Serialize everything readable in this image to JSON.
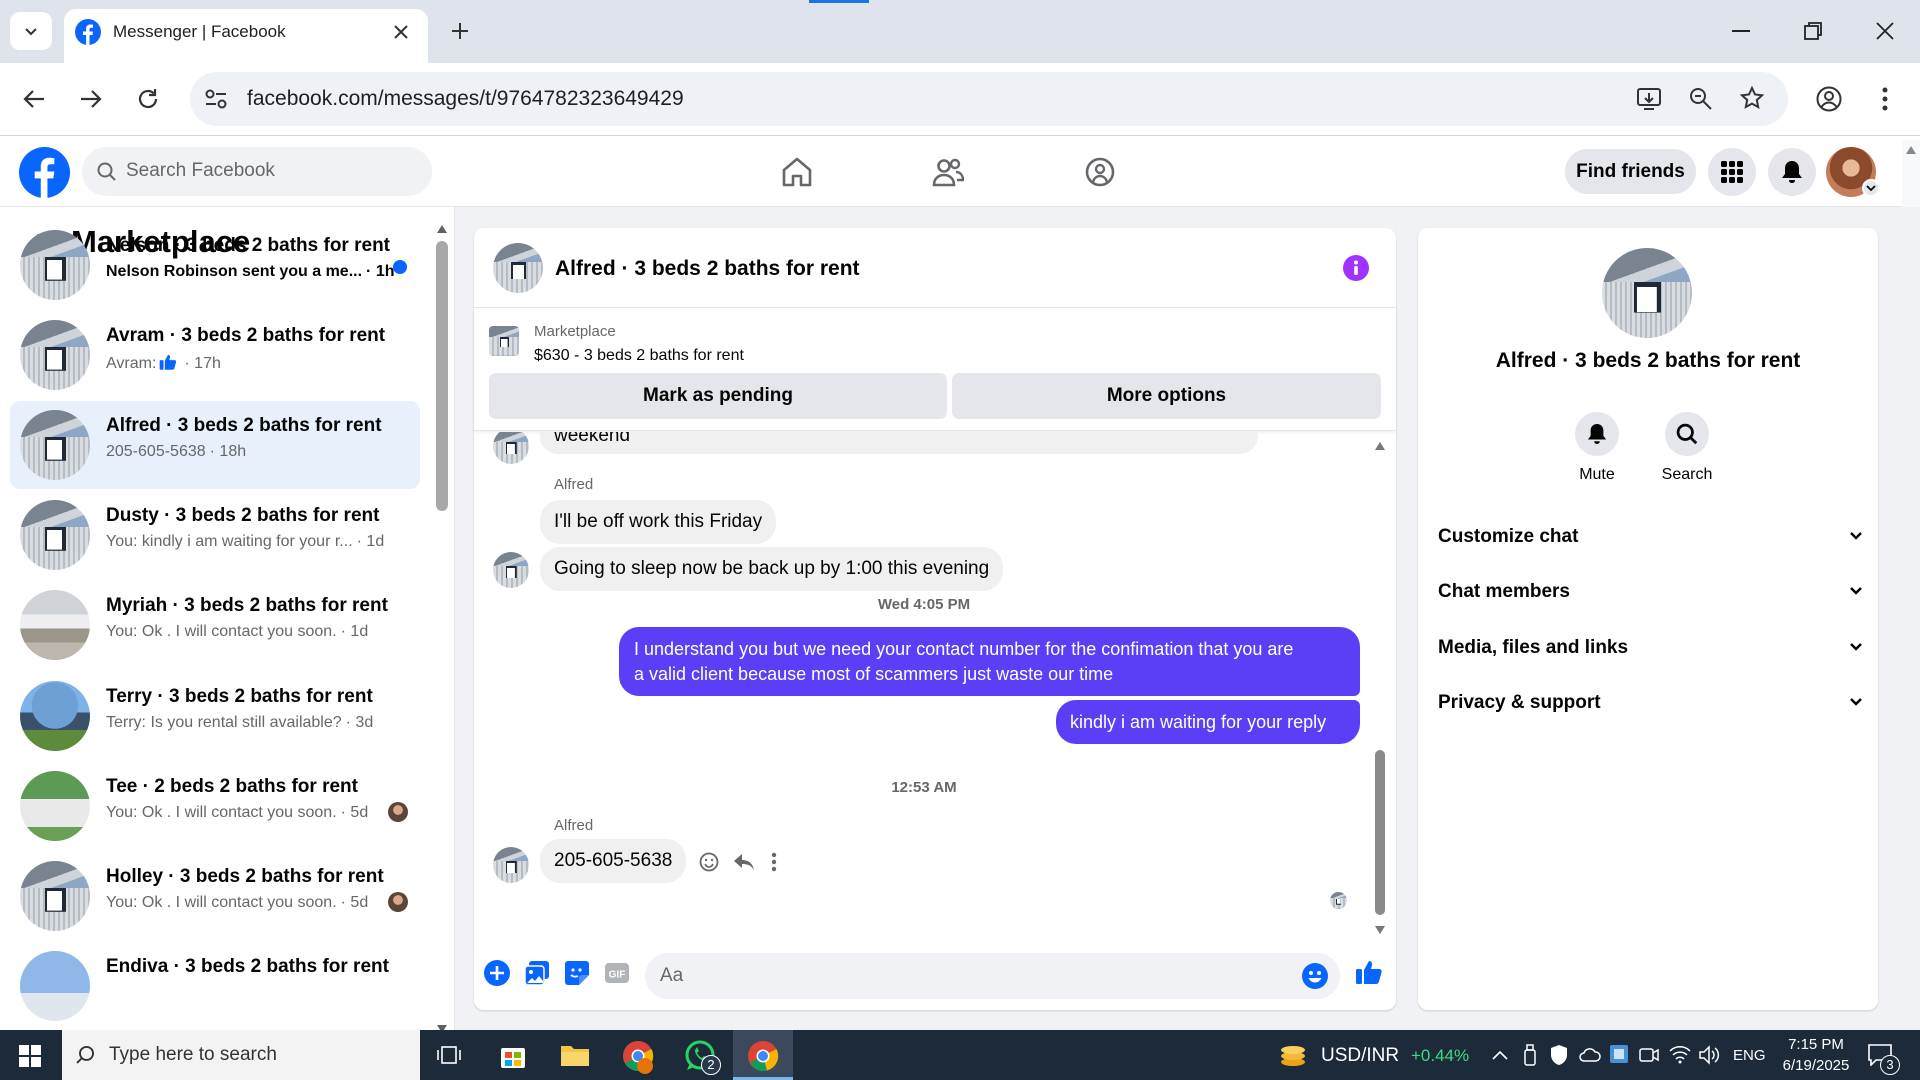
{
  "browser": {
    "tab_title": "Messenger | Facebook",
    "url": "facebook.com/messages/t/9764782323649429"
  },
  "fb": {
    "search_placeholder": "Search Facebook",
    "find_friends": "Find friends"
  },
  "sidebar": {
    "title": "Marketplace",
    "conversations": [
      {
        "name": "Nelson · 3 beds 2 baths for rent",
        "preview": "Nelson Robinson sent you a me...",
        "time": "· 1h",
        "unread": true
      },
      {
        "name": "Avram · 3 beds 2 baths for rent",
        "preview": "Avram:",
        "time": "· 17h",
        "thumb": true
      },
      {
        "name": "Alfred · 3 beds 2 baths for rent",
        "preview": "205-605-5638",
        "time": "· 18h",
        "selected": true
      },
      {
        "name": "Dusty · 3 beds 2 baths for rent",
        "preview": "You: kindly i am waiting for your r...",
        "time": "· 1d"
      },
      {
        "name": "Myriah · 3 beds 2 baths for rent",
        "preview": "You: Ok . I will contact you soon.",
        "time": "· 1d"
      },
      {
        "name": "Terry · 3 beds 2 baths for rent",
        "preview": "Terry: Is you rental still available?",
        "time": "· 3d"
      },
      {
        "name": "Tee · 2 beds 2 baths for rent",
        "preview": "You: Ok . I will contact you soon.",
        "time": "· 5d"
      },
      {
        "name": "Holley · 3 beds 2 baths for rent",
        "preview": "You: Ok . I will contact you soon.",
        "time": "· 5d"
      },
      {
        "name": "Endiva · 3 beds 2 baths for rent",
        "preview": "",
        "time": ""
      }
    ]
  },
  "chat": {
    "title": "Alfred · 3 beds 2 baths for rent",
    "listing_source": "Marketplace",
    "listing": "$630 - 3 beds 2 baths for rent",
    "mark_pending": "Mark as pending",
    "more_options": "More options",
    "messages": {
      "partial": "weekend",
      "sender1": "Alfred",
      "m1": "I'll be off work this Friday",
      "m2": "Going to sleep now be back up by 1:00 this evening",
      "time1": "Wed 4:05 PM",
      "m3_line1": "I understand you but we need your contact number for the confimation that you are",
      "m3_line2": "a valid client because most of scammers just waste our time",
      "m4": "kindly i am waiting for your reply",
      "time2": "12:53 AM",
      "sender2": "Alfred",
      "m5": "205-605-5638"
    },
    "input_placeholder": "Aa"
  },
  "details": {
    "name": "Alfred · 3 beds 2 baths for rent",
    "mute": "Mute",
    "search": "Search",
    "sections": [
      "Customize chat",
      "Chat members",
      "Media, files and links",
      "Privacy & support"
    ]
  },
  "taskbar": {
    "search_placeholder": "Type here to search",
    "whatsapp_badge": "2",
    "ticker": "USD/INR",
    "ticker_change": "+0.44%",
    "lang": "ENG",
    "time": "7:15 PM",
    "date": "6/19/2025",
    "notif_count": "3"
  },
  "colors": {
    "fb_blue": "#0866ff",
    "my_bubble": "#5b3ff6",
    "info_purple": "#a033ff",
    "ticker_green": "#3ddc84"
  }
}
